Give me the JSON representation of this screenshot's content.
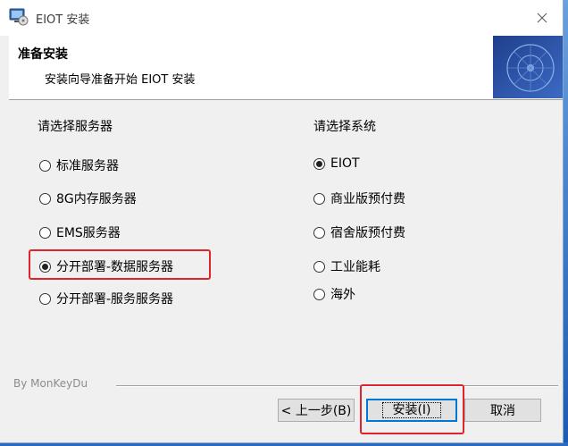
{
  "window": {
    "title": "EIOT 安装"
  },
  "header": {
    "title": "准备安装",
    "subtitle": "安装向导准备开始 EIOT 安装"
  },
  "server_group": {
    "label": "请选择服务器",
    "options": [
      {
        "label": "标准服务器",
        "checked": false
      },
      {
        "label": "8G内存服务器",
        "checked": false
      },
      {
        "label": "EMS服务器",
        "checked": false
      },
      {
        "label": "分开部署-数据服务器",
        "checked": true
      },
      {
        "label": "分开部署-服务服务器",
        "checked": false
      }
    ]
  },
  "system_group": {
    "label": "请选择系统",
    "options": [
      {
        "label": "EIOT",
        "checked": true
      },
      {
        "label": "商业版预付费",
        "checked": false
      },
      {
        "label": "宿舍版预付费",
        "checked": false
      },
      {
        "label": "工业能耗",
        "checked": false
      },
      {
        "label": "海外",
        "checked": false
      }
    ]
  },
  "footer": {
    "brand": "By MonKeyDu",
    "back_label": "< 上一步(B)",
    "install_label": "安装(I)",
    "cancel_label": "取消"
  },
  "colors": {
    "highlight": "#e0222a",
    "focus": "#0078d7"
  }
}
